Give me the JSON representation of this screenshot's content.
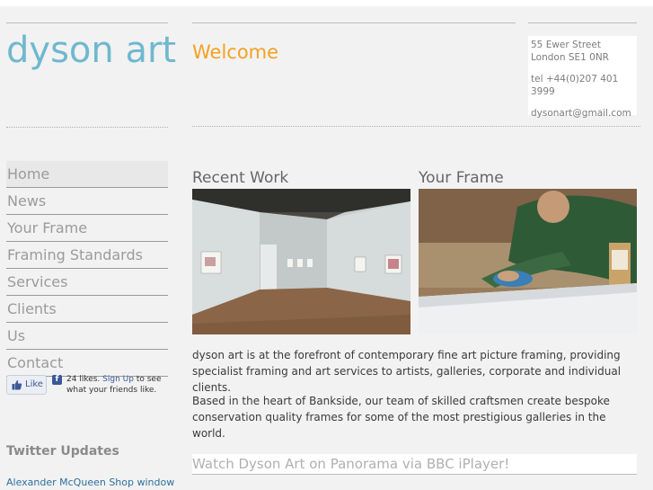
{
  "logo": "dyson art",
  "welcome": "Welcome",
  "address": {
    "street": "55 Ewer Street",
    "city": "London SE1 0NR",
    "tel": "tel +44(0)207 401 3999",
    "email": "dysonart@gmail.com"
  },
  "nav": [
    "Home",
    "News",
    "Your Frame",
    "Framing Standards",
    "Services",
    "Clients",
    "Us",
    "Contact"
  ],
  "facebook": {
    "like": "Like",
    "likes": "24 likes.",
    "signup": "Sign Up",
    "rest": "to see what your friends like."
  },
  "sections": {
    "recent_work": "Recent Work",
    "your_frame": "Your Frame"
  },
  "paragraphs": [
    "dyson art is at the forefront of contemporary fine art picture framing, providing specialist framing and art services to artists, galleries, corporate and individual clients.",
    "Based in the heart of Bankside, our team of skilled craftsmen create bespoke conservation quality frames for some of the most prestigious galleries in the world."
  ],
  "panorama": "Watch Dyson Art on Panorama via BBC iPlayer!",
  "twitter": {
    "title": "Twitter Updates",
    "link": "Alexander McQueen Shop window"
  },
  "colors": {
    "logo": "#6fb8cf",
    "welcome": "#f5a022",
    "link": "#2f6f9c"
  }
}
